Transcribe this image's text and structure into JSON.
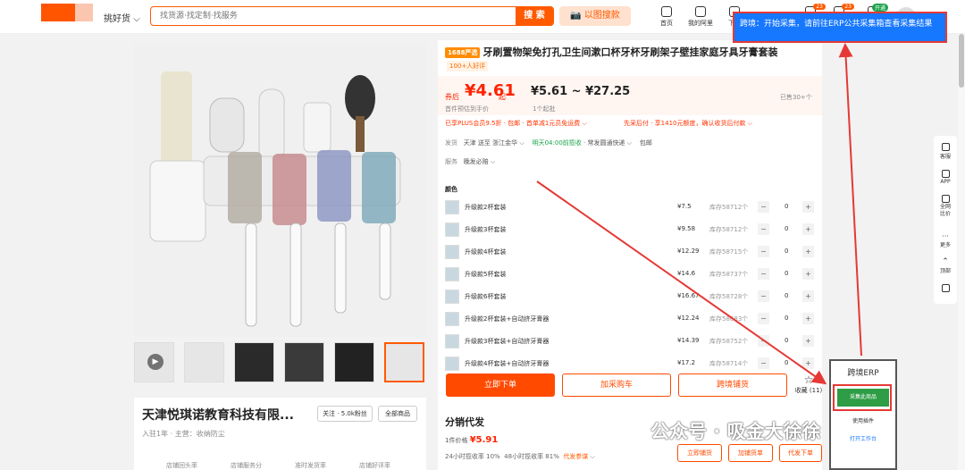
{
  "header": {
    "category": "挑好货",
    "search_placeholder": "找货源·找定制·找服务",
    "search_button": "搜 索",
    "image_search": "以图搜款",
    "nav": [
      {
        "label": "首页",
        "badge": ""
      },
      {
        "label": "我的阿里",
        "badge": ""
      },
      {
        "label": "下单",
        "badge": ""
      },
      {
        "label": "",
        "badge": "23"
      },
      {
        "label": "",
        "badge": "23"
      },
      {
        "label": "",
        "badge": "开通"
      }
    ]
  },
  "erp_tip": "跨境：开始采集，请前往ERP公共采集箱查看采集结果",
  "product": {
    "tag": "1688严选",
    "title": "牙刷置物架免打孔卫生间漱口杯牙杯牙刷架子壁挂家庭牙具牙膏套装",
    "hot": "100+人好评",
    "price_label": "券后",
    "price": "¥4.61",
    "price_suffix": "起",
    "price_sub": "首件预估到手价",
    "range": "¥5.61 ~ ¥27.25",
    "min_order": "1个起批",
    "sold": "已售30+个",
    "promo1": "已享PLUS会员9.5折 · 包邮 · 首单减1元员免运费",
    "promo2": "先采后付 · 享1410元额度，确认收货后付款",
    "ship_label": "发货",
    "ship_from": "天津",
    "ship_to": "送至 浙江金华",
    "ship_time": "明天04:00前揽收",
    "ship_method": "常发圆通快递",
    "ship_fee": "包邮",
    "service_label": "服务",
    "service": "晚发必赔",
    "color_label": "颜色"
  },
  "skus": [
    {
      "name": "升级款2杯套装",
      "price": "¥7.5",
      "stock": "库存58712个",
      "qty": "0"
    },
    {
      "name": "升级款3杯套装",
      "price": "¥9.58",
      "stock": "库存58712个",
      "qty": "0"
    },
    {
      "name": "升级款4杯套装",
      "price": "¥12.29",
      "stock": "库存58715个",
      "qty": "0"
    },
    {
      "name": "升级款5杯套装",
      "price": "¥14.6",
      "stock": "库存58737个",
      "qty": "0"
    },
    {
      "name": "升级款6杯套装",
      "price": "¥16.67",
      "stock": "库存58728个",
      "qty": "0"
    },
    {
      "name": "升级款2杯套装+自动挤牙膏器",
      "price": "¥12.24",
      "stock": "库存58683个",
      "qty": "0"
    },
    {
      "name": "升级款3杯套装+自动挤牙膏器",
      "price": "¥14.39",
      "stock": "库存58752个",
      "qty": "0"
    },
    {
      "name": "升级款4杯套装+自动挤牙膏器",
      "price": "¥17.2",
      "stock": "库存58714个",
      "qty": "0"
    }
  ],
  "actions": {
    "order": "立即下单",
    "cart": "加采购车",
    "cross": "跨境铺货",
    "fav": "收藏 (11)"
  },
  "dist": {
    "title": "分销代发",
    "price_label": "1件价格",
    "price": "¥5.91",
    "stat1": "24小时揽收率 10%",
    "stat2": "48小时揽收率 81%",
    "rule": "代发参谋",
    "b1": "立即铺货",
    "b2": "加铺货单",
    "b3": "代发下单"
  },
  "shop": {
    "name": "天津悦琪诺教育科技有限...",
    "meta": "入驻1年 · 主营：收纳防尘",
    "follow": "关注 · 5.0k粉丝",
    "all": "全部商品",
    "stats": [
      "店铺回头率",
      "店铺服务分",
      "准时发货率",
      "店铺好评率"
    ]
  },
  "side": [
    "客服",
    "APP",
    "全网比价",
    "更多",
    "顶部",
    ""
  ],
  "erp": {
    "title": "跨境ERP",
    "collect": "采集此商品",
    "sub1": "使用插件",
    "sub2": "打开工作台"
  },
  "watermark": "公众号 · 吸金大徐徐"
}
